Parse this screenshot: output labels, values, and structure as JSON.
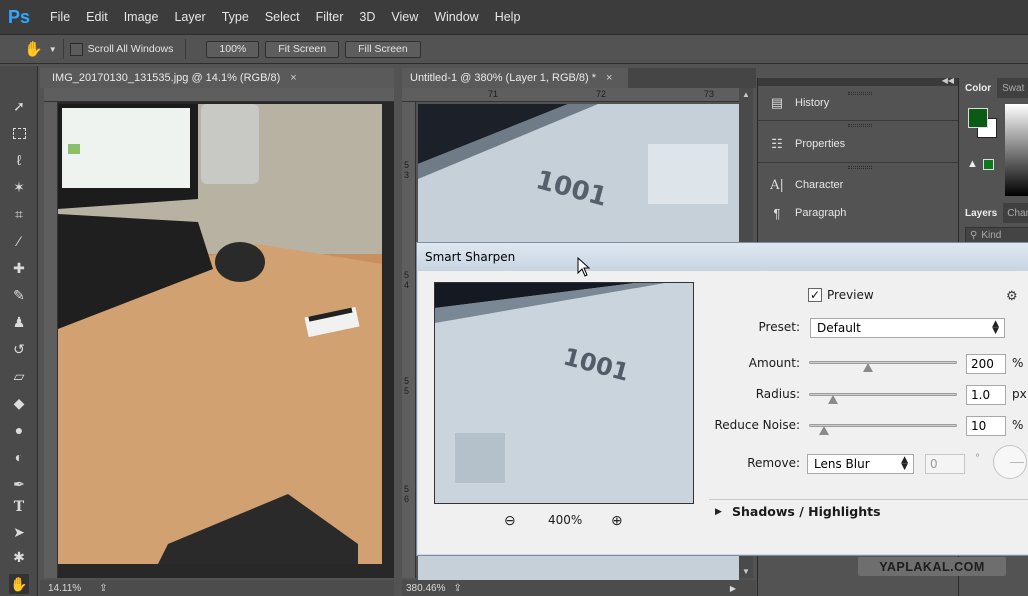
{
  "app": {
    "logo": "Ps"
  },
  "menu": [
    "File",
    "Edit",
    "Image",
    "Layer",
    "Type",
    "Select",
    "Filter",
    "3D",
    "View",
    "Window",
    "Help"
  ],
  "options": {
    "scroll_all_label": "Scroll All Windows",
    "zoom_100": "100%",
    "fit_screen": "Fit Screen",
    "fill_screen": "Fill Screen"
  },
  "docs": [
    {
      "title": "IMG_20170130_131535.jpg @ 14.1% (RGB/8)",
      "close": "×",
      "zoom": "14.11%"
    },
    {
      "title": "Untitled-1 @ 380% (Layer 1, RGB/8) *",
      "close": "×",
      "zoom": "380.46%"
    }
  ],
  "rulers": {
    "h2": [
      "71",
      "72",
      "73"
    ],
    "v2": [
      "5",
      "3",
      "5",
      "4",
      "5",
      "5",
      "5",
      "6"
    ]
  },
  "canvas2_text": "1001",
  "panels": {
    "history": "History",
    "properties": "Properties",
    "character": "Character",
    "paragraph": "Paragraph",
    "color": "Color",
    "swatches": "Swat",
    "layers": "Layers",
    "channels": "Char",
    "kind": "Kind"
  },
  "dialog": {
    "title": "Smart Sharpen",
    "preview_label": "Preview",
    "preview_checked": true,
    "zoom": "400%",
    "preset_label": "Preset:",
    "preset_value": "Default",
    "amount_label": "Amount:",
    "amount_value": "200",
    "amount_unit": "%",
    "radius_label": "Radius:",
    "radius_value": "1.0",
    "radius_unit": "px",
    "noise_label": "Reduce Noise:",
    "noise_value": "10",
    "noise_unit": "%",
    "remove_label": "Remove:",
    "remove_value": "Lens Blur",
    "angle_value": "0",
    "angle_unit": "°",
    "shadows_label": "Shadows / Highlights"
  },
  "watermark": "YAPLAKAL.COM",
  "colors": {
    "foreground": "#0b5a16",
    "background": "#ffffff",
    "ps_blue": "#31a8ff"
  }
}
